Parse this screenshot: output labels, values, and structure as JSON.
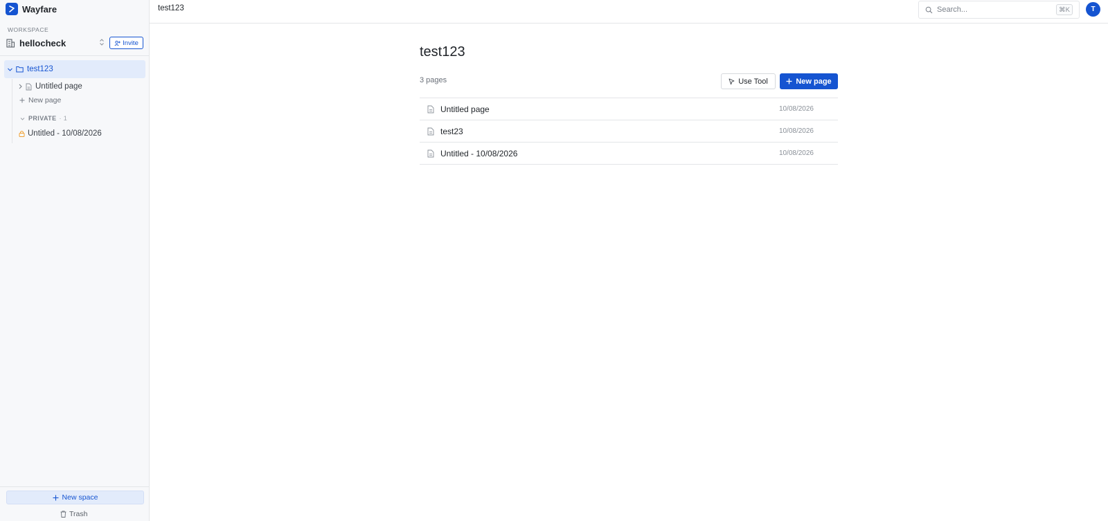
{
  "app": {
    "name": "Wayfare"
  },
  "workspace": {
    "section_label": "WORKSPACE",
    "name": "hellocheck",
    "invite_label": "Invite"
  },
  "sidebar": {
    "active_space": "test123",
    "children": [
      {
        "label": "Untitled page"
      }
    ],
    "new_page_label": "New page",
    "private": {
      "title": "PRIVATE",
      "count": "· 1",
      "items": [
        {
          "label": "Untitled - 10/08/2026"
        }
      ]
    },
    "new_space_label": "New space",
    "trash_label": "Trash"
  },
  "topbar": {
    "breadcrumb": "test123",
    "search_placeholder": "Search...",
    "search_shortcut": "⌘K",
    "avatar_initial": "T"
  },
  "main": {
    "title": "test123",
    "page_count": "3 pages",
    "use_tool_label": "Use Tool",
    "new_page_label": "New page",
    "pages": [
      {
        "title": "Untitled page",
        "date": "10/08/2026"
      },
      {
        "title": "test23",
        "date": "10/08/2026"
      },
      {
        "title": "Untitled - 10/08/2026",
        "date": "10/08/2026"
      }
    ]
  },
  "colors": {
    "accent": "#1554d1",
    "lock": "#f0a030"
  }
}
